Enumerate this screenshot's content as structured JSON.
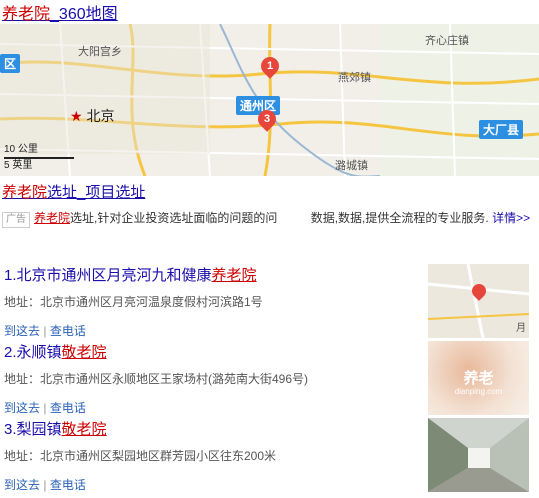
{
  "search": {
    "title_hl": "养老院",
    "title_rest": "_360地图"
  },
  "map": {
    "places": {
      "daxing_palace": "大阳宫乡",
      "beijing": "北京",
      "tongzhou": "通州区",
      "yanjiao": "燕郊镇",
      "qixinzhuang": "齐心庄镇",
      "dachang": "大厂县",
      "luchengzhen": "潞城镇",
      "district_left": "区"
    },
    "pins": [
      "1",
      "3"
    ],
    "scale": {
      "km": "10 公里",
      "mi": "5 英里"
    },
    "colors": {
      "badge": "#2d8fe2",
      "pin": "#e7463b"
    }
  },
  "ad": {
    "title_hl": "养老院",
    "title_rest": "选址_项目选址",
    "tag": "广告",
    "desc_hl": "养老院",
    "desc_rest": "选址,针对企业投资选址面临的问题的问",
    "desc_tail": "数据,数据,提供全流程的专业服务.",
    "details_link": "详情>>"
  },
  "results": [
    {
      "num": "1.",
      "name": "北京市通州区月亮河九和健康",
      "hl": "养老院",
      "address": "地址：北京市通州区月亮河温泉度假村河滨路1号",
      "go": "到这去",
      "call": "查电话",
      "thumb_caption": "月"
    },
    {
      "num": "2.",
      "name": "永顺镇",
      "hl": "敬老院",
      "address": "地址：北京市通州区永顺地区王家场村(潞苑南大街496号)",
      "go": "到这去",
      "call": "查电话",
      "thumb_caption": "养老",
      "thumb_sub": "dianping.com"
    },
    {
      "num": "3.",
      "name": "梨园镇",
      "hl": "敬老院",
      "address": "地址：北京市通州区梨园地区群芳园小区往东200米",
      "go": "到这去",
      "call": "查电话"
    }
  ],
  "separator": "|"
}
